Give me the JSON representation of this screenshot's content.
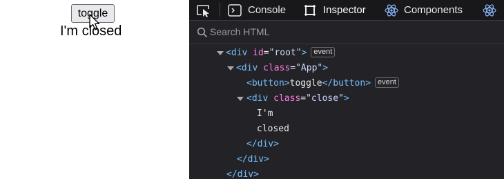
{
  "page": {
    "button_label": "toggle",
    "status_text": "I'm closed"
  },
  "devtools": {
    "tabs": [
      {
        "label": "Console"
      },
      {
        "label": "Inspector"
      },
      {
        "label": "Components"
      }
    ],
    "search_placeholder": "Search HTML",
    "tree": {
      "root_open": "<div",
      "root_attr": "id",
      "root_val": "\"root\"",
      "root_close": ">",
      "root_badge": "event",
      "app_open": "<div",
      "app_attr": "class",
      "app_val": "\"App\"",
      "app_close": ">",
      "button_open": "<button>",
      "button_text": "toggle",
      "button_close": "</button>",
      "button_badge": "event",
      "close_open": "<div",
      "close_attr": "class",
      "close_val": "\"close\"",
      "close_close": ">",
      "text_line1": "I'm",
      "text_line2": "closed",
      "end_div1": "</div>",
      "end_div2": "</div>",
      "end_div3": "</div>"
    }
  }
}
